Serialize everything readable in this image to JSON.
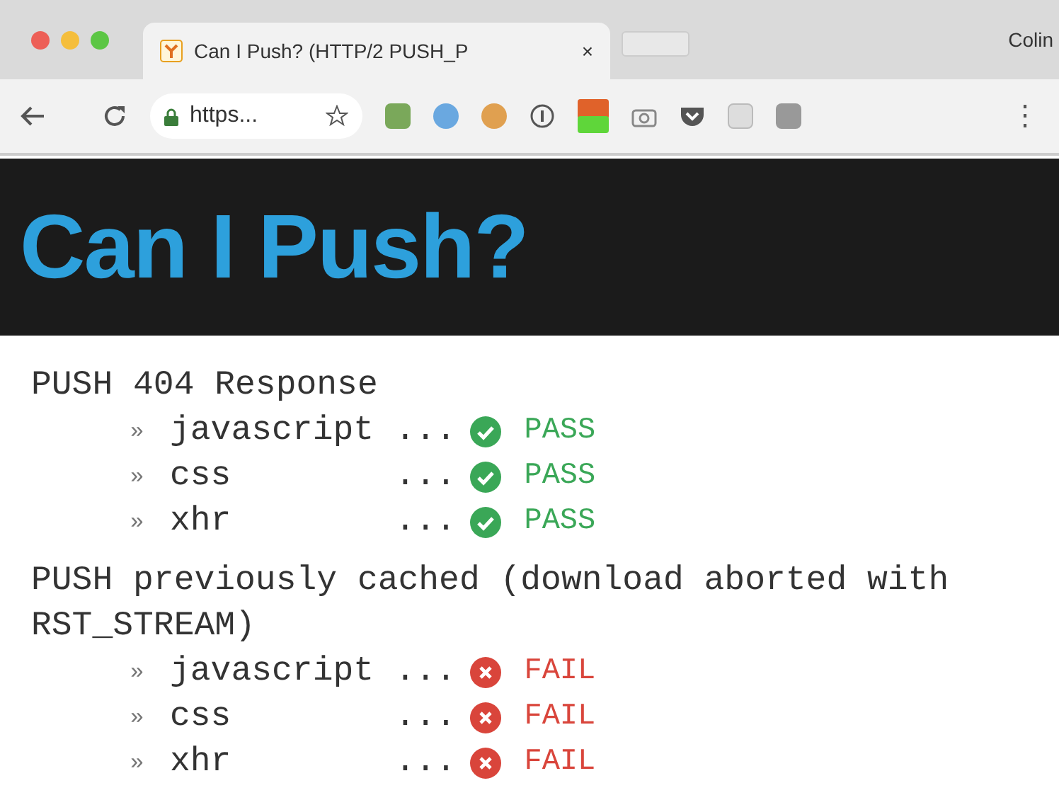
{
  "browser": {
    "tab": {
      "title": "Can I Push? (HTTP/2 PUSH_P",
      "close": "×"
    },
    "profile": "Colin",
    "address": "https...",
    "menu": "⋮"
  },
  "header": {
    "title": "Can I Push?"
  },
  "sections": [
    {
      "heading": "PUSH 404 Response",
      "tests": [
        {
          "bullet": "»",
          "name": "javascript",
          "dots": "...",
          "kind": "pass",
          "result": "PASS"
        },
        {
          "bullet": "»",
          "name": "css",
          "dots": "...",
          "kind": "pass",
          "result": "PASS"
        },
        {
          "bullet": "»",
          "name": "xhr",
          "dots": "...",
          "kind": "pass",
          "result": "PASS"
        }
      ]
    },
    {
      "heading": "PUSH previously cached (download aborted with RST_STREAM)",
      "tests": [
        {
          "bullet": "»",
          "name": "javascript",
          "dots": "...",
          "kind": "fail",
          "result": "FAIL"
        },
        {
          "bullet": "»",
          "name": "css",
          "dots": "...",
          "kind": "fail",
          "result": "FAIL"
        },
        {
          "bullet": "»",
          "name": "xhr",
          "dots": "...",
          "kind": "fail",
          "result": "FAIL"
        }
      ]
    }
  ]
}
